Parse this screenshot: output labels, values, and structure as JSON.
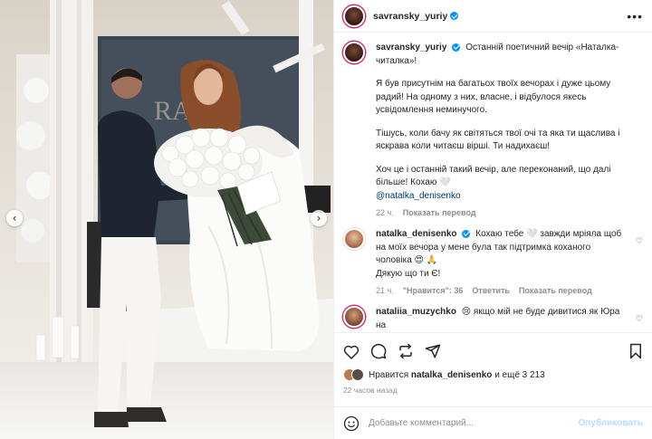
{
  "post": {
    "author": "savransky_yuriy",
    "more_icon": "more-horizontal-icon"
  },
  "caption": {
    "username": "savransky_yuriy",
    "paragraphs": [
      "Останній поетичний вечір «Наталка-читалка»!",
      "Я був присутнім на багатьох твоїх вечорах і дуже цьому радий! На одному з них, власне, і відбулося якесь усвідомлення неминучого.",
      "Тішусь, коли бачу як світяться твої очі та яка ти щаслива і яскрава коли читаєш вірші. Ти надихаєш!",
      "Хоч це і останній такий вечір, але переконаний, що далі більше! Кохаю 🤍"
    ],
    "mention": "@natalka_denisenko",
    "time": "22 ч.",
    "translate": "Показать перевод"
  },
  "comments": [
    {
      "username": "natalka_denisenko",
      "text": "Кохаю тебе 🤍 завжди мріяла щоб на моїх вечора у мене була так підтримка коханого чоловіка 😍 🙏",
      "text2": "Дякую що ти Є!",
      "time": "21 ч.",
      "likes": "\"Нравится\": 36",
      "reply": "Ответить",
      "translate": "Показать перевод"
    },
    {
      "username": "nataliia_muzychko",
      "text": "😢 якщо мій не буде дивитися як Юра на"
    }
  ],
  "likes": {
    "prefix": "Нравится",
    "user": "natalka_denisenko",
    "suffix": "и ещё 3 213"
  },
  "timestamp": "22 часов назад",
  "comment_box": {
    "placeholder": "Добавьте комментарий...",
    "publish": "Опубликовать"
  },
  "colors": {
    "verified": "#0095f6",
    "story_ring": "#d62976",
    "publish_disabled": "#b2dffc",
    "link": "#00376b"
  }
}
